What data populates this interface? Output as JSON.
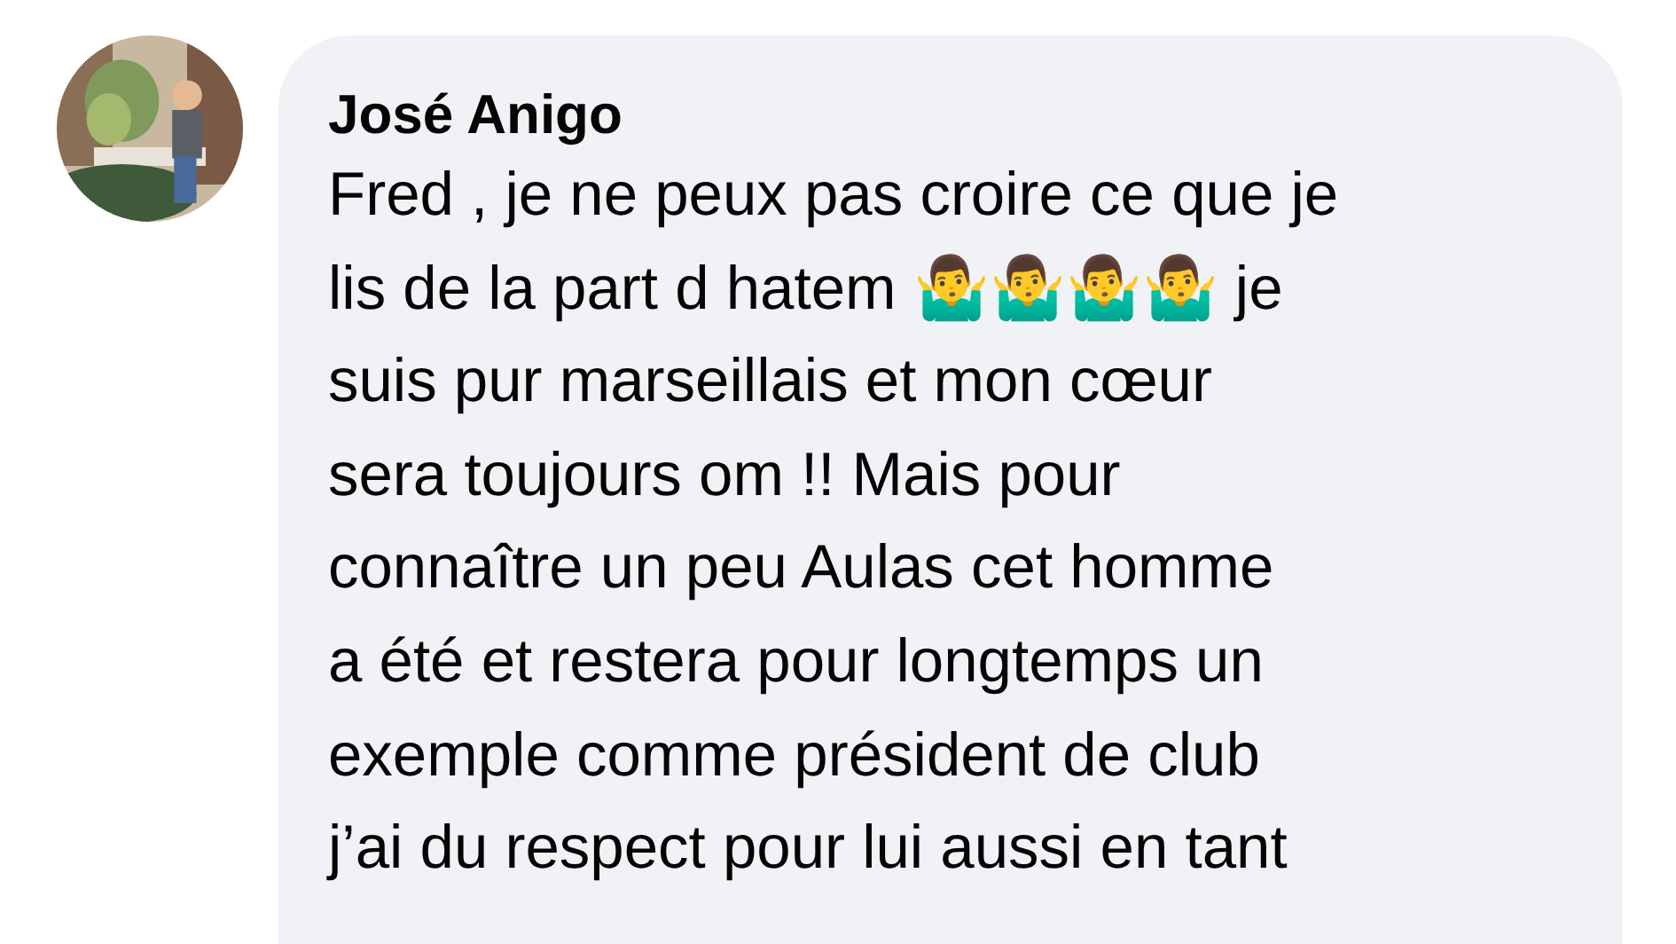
{
  "comment": {
    "author": "José Anigo",
    "lines": [
      "Fred , je ne peux pas croire ce que je",
      "lis de la part d hatem 🤷‍♂️🤷‍♂️🤷‍♂️🤷‍♂️ je",
      "suis pur marseillais et mon cœur",
      "sera toujours om !! Mais pour",
      "connaître un peu Aulas cet homme",
      "a été et restera pour longtemps un",
      "exemple comme président de club",
      "j’ai du respect pour lui aussi en tant"
    ]
  }
}
